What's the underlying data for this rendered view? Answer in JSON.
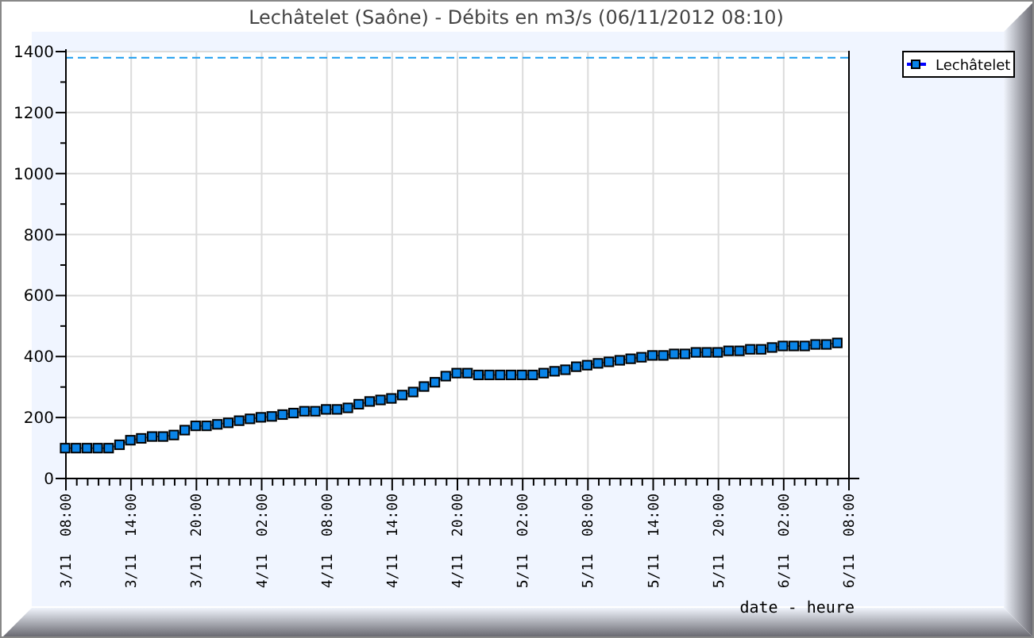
{
  "chart_data": {
    "type": "line",
    "title": "Lechâtelet (Saône) - Débits en m3/s (06/11/2012 08:10)",
    "xlabel": "date - heure",
    "categories": [
      "3/11  08:00",
      null,
      null,
      null,
      null,
      null,
      "3/11  14:00",
      null,
      null,
      null,
      null,
      null,
      "3/11  20:00",
      null,
      null,
      null,
      null,
      null,
      "4/11  02:00",
      null,
      null,
      null,
      null,
      null,
      "4/11  08:00",
      null,
      null,
      null,
      null,
      null,
      "4/11  14:00",
      null,
      null,
      null,
      null,
      null,
      "4/11  20:00",
      null,
      null,
      null,
      null,
      null,
      "5/11  02:00",
      null,
      null,
      null,
      null,
      null,
      "5/11  08:00",
      null,
      null,
      null,
      null,
      null,
      "5/11  14:00",
      null,
      null,
      null,
      null,
      null,
      "5/11  20:00",
      null,
      null,
      null,
      null,
      null,
      "6/11  02:00",
      null,
      null,
      null,
      null,
      null,
      "6/11  08:00"
    ],
    "series": [
      {
        "name": "Lechâtelet",
        "color": "#0a84e8",
        "marker": "square",
        "values": [
          97,
          97,
          97,
          97,
          97,
          108,
          123,
          129,
          135,
          135,
          140,
          156,
          170,
          170,
          175,
          180,
          187,
          193,
          198,
          201,
          207,
          212,
          218,
          218,
          224,
          224,
          229,
          241,
          250,
          255,
          260,
          271,
          281,
          299,
          313,
          333,
          343,
          343,
          337,
          337,
          337,
          337,
          337,
          337,
          343,
          349,
          354,
          364,
          369,
          375,
          380,
          385,
          390,
          395,
          401,
          401,
          406,
          406,
          411,
          411,
          411,
          416,
          416,
          421,
          421,
          427,
          432,
          432,
          432,
          437,
          437,
          442,
          null
        ]
      }
    ],
    "ylim": [
      0,
      1400
    ],
    "yticks": [
      0,
      200,
      400,
      600,
      800,
      1000,
      1200,
      1400
    ],
    "grid": true,
    "ref_lines": [
      {
        "axis": "y",
        "value": 1380
      }
    ]
  }
}
